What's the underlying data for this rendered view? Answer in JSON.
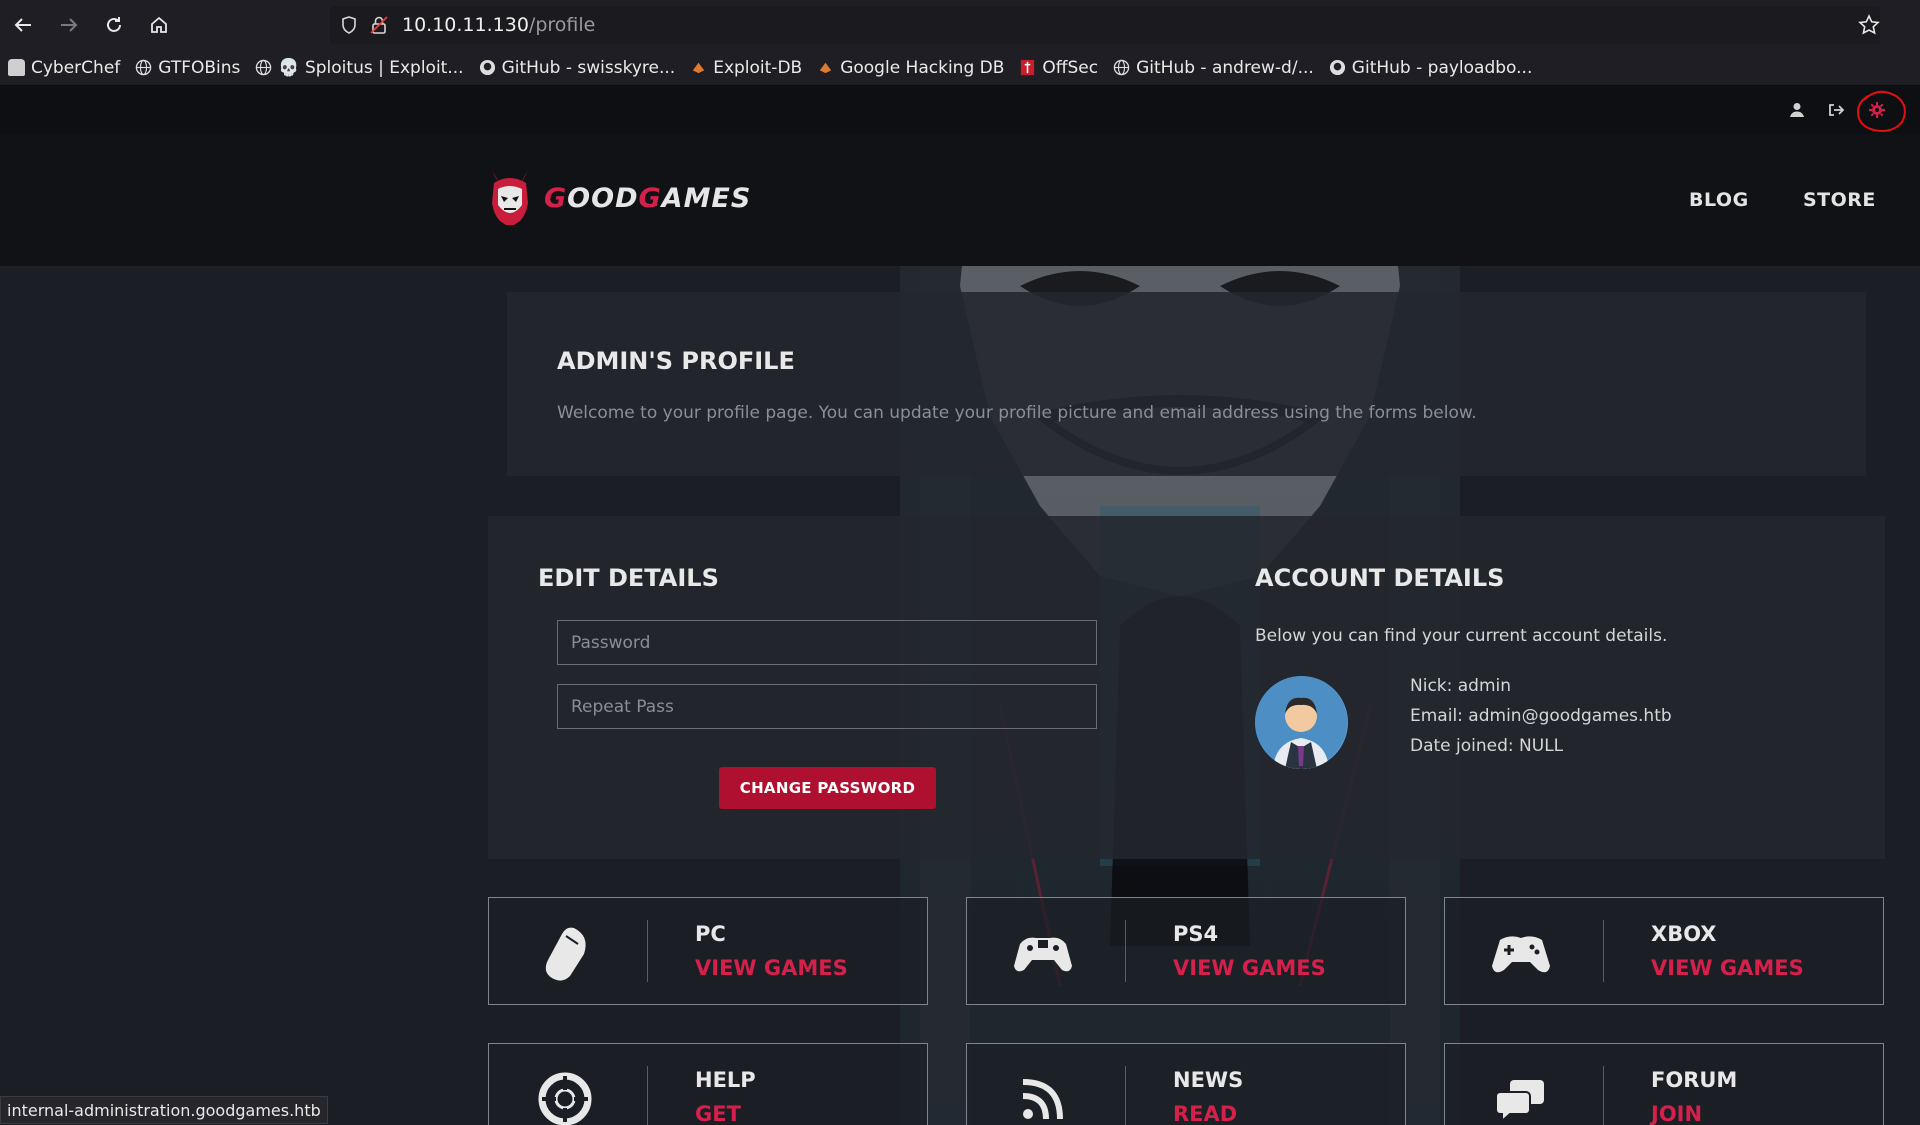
{
  "browser": {
    "url_host": "10.10.11.130",
    "url_path": "/profile",
    "bookmarks": [
      {
        "label": "CyberChef",
        "icon": "chef-icon"
      },
      {
        "label": "GTFOBins",
        "icon": "globe-icon"
      },
      {
        "label": "💀 Sploitus | Exploit...",
        "icon": "globe-icon"
      },
      {
        "label": "GitHub - swisskyre...",
        "icon": "github-icon"
      },
      {
        "label": "Exploit-DB",
        "icon": "bug-icon"
      },
      {
        "label": "Google Hacking DB",
        "icon": "bug-icon"
      },
      {
        "label": "OffSec",
        "icon": "offsec-icon"
      },
      {
        "label": "GitHub - andrew-d/...",
        "icon": "globe-icon"
      },
      {
        "label": "GitHub - payloadbo...",
        "icon": "github-icon"
      }
    ],
    "status_url": "internal-administration.goodgames.htb"
  },
  "site": {
    "logo_prefix": "G",
    "logo_mid": "OOD",
    "logo_g2": "G",
    "logo_suffix": "AMES",
    "nav": {
      "blog": "BLOG",
      "store": "STORE"
    },
    "colors": {
      "accent": "#d4204a",
      "button": "#b0102f"
    }
  },
  "profile": {
    "title": "ADMIN'S PROFILE",
    "description": "Welcome to your profile page. You can update your profile picture and email address using the forms below."
  },
  "edit": {
    "title": "EDIT DETAILS",
    "password_placeholder": "Password",
    "repeat_placeholder": "Repeat Pass",
    "button": "CHANGE PASSWORD"
  },
  "account": {
    "title": "ACCOUNT DETAILS",
    "description": "Below you can find your current account details.",
    "nick": "Nick: admin",
    "email": "Email: admin@goodgames.htb",
    "joined": "Date joined: NULL"
  },
  "tiles": [
    {
      "title": "PC",
      "link": "VIEW GAMES",
      "icon": "mouse-icon"
    },
    {
      "title": "PS4",
      "link": "VIEW GAMES",
      "icon": "ps4-controller-icon"
    },
    {
      "title": "XBOX",
      "link": "VIEW GAMES",
      "icon": "xbox-controller-icon"
    },
    {
      "title": "HELP",
      "link": "GET",
      "icon": "lifebuoy-icon"
    },
    {
      "title": "NEWS",
      "link": "READ",
      "icon": "rss-icon"
    },
    {
      "title": "FORUM",
      "link": "JOIN",
      "icon": "chat-icon"
    }
  ]
}
